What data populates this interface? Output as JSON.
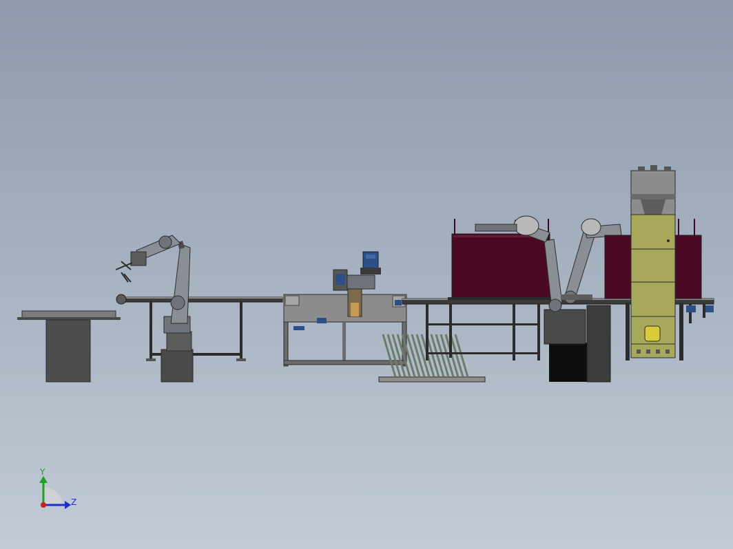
{
  "viewport": {
    "background_top": "#8e9aab",
    "background_bottom": "#c2cbd6"
  },
  "triad": {
    "y_label": "Y",
    "z_label": "Z",
    "y_color": "#1fa01f",
    "z_color": "#1f2fc8",
    "origin_color": "#c81f1f"
  },
  "colors": {
    "frame": "#2b2b2b",
    "steel_dark": "#4a4a4a",
    "steel_mid": "#7c7c7c",
    "steel_light": "#b9b9b9",
    "robot_gray": "#8a8f96",
    "enclosure_maroon": "#4a0a24",
    "cabinet_olive": "#a8a85a",
    "motor_blue": "#2c4f86",
    "grating": "#6d7a6a"
  },
  "components": [
    "left-table",
    "robot-left",
    "conveyor-left",
    "press-station",
    "grating",
    "conveyor-right",
    "enclosure-left",
    "robot-right-1",
    "robot-right-2",
    "enclosure-right",
    "control-cabinet"
  ]
}
